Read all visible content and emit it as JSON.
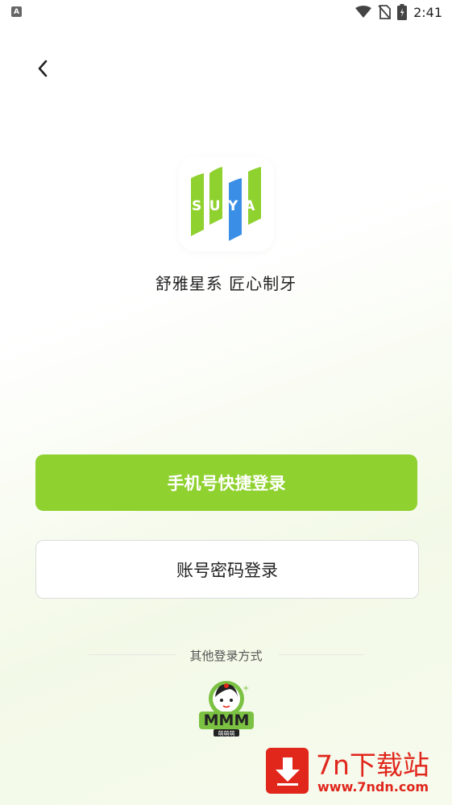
{
  "status_bar": {
    "left_badge": "A",
    "time": "2:41"
  },
  "header": {
    "back_icon": "chevron-left-icon"
  },
  "logo": {
    "text": "SUYA",
    "colors": {
      "green": "#8fd12f",
      "blue": "#3a8ee6"
    }
  },
  "slogan": "舒雅星系  匠心制牙",
  "buttons": {
    "phone_login": "手机号快捷登录",
    "password_login": "账号密码登录"
  },
  "other_login": {
    "label": "其他登录方式",
    "provider_icon": "mmm-app-icon",
    "provider_logo_text": "MMM",
    "provider_sub_text": "萌萌萌"
  },
  "watermark": {
    "title": "7n下载站",
    "url": "www.7ndn.com",
    "color": "#e1261c"
  },
  "colors": {
    "primary": "#8fd12f",
    "border": "#dcdcdc"
  }
}
